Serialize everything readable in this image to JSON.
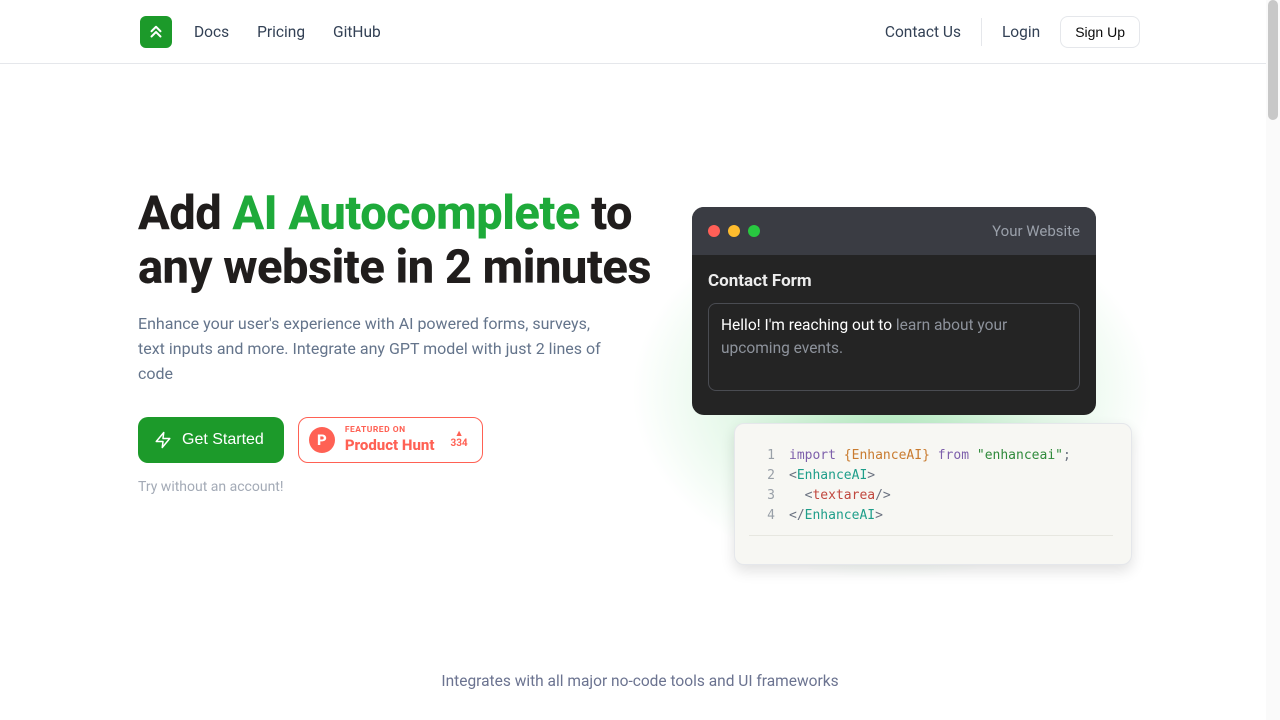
{
  "nav": {
    "links": {
      "docs": "Docs",
      "pricing": "Pricing",
      "github": "GitHub"
    },
    "contact": "Contact Us",
    "login": "Login",
    "signup": "Sign Up"
  },
  "hero": {
    "h1_pre": "Add ",
    "h1_accent": "AI Autocomplete",
    "h1_rest": " to any website in 2 minutes",
    "sub": "Enhance your user's experience with AI powered forms, surveys, text inputs and more. Integrate any GPT model with just 2 lines of code",
    "cta": "Get Started",
    "ph_featured": "FEATURED ON",
    "ph_name": "Product Hunt",
    "ph_votes": "334",
    "try": "Try without an account!"
  },
  "window": {
    "title": "Your Website",
    "form_title": "Contact Form",
    "typed": "Hello! I'm reaching out to ",
    "suggest": "learn about your upcoming events."
  },
  "code": {
    "l1_import": "import",
    "l1_ident": "EnhanceAI",
    "l1_from": "from",
    "l1_str": "\"enhanceai\"",
    "l2_tag": "EnhanceAI",
    "l3_tag": "textarea",
    "l4_tag": "EnhanceAI"
  },
  "footer": {
    "integrates": "Integrates with all major no-code tools and UI frameworks"
  }
}
